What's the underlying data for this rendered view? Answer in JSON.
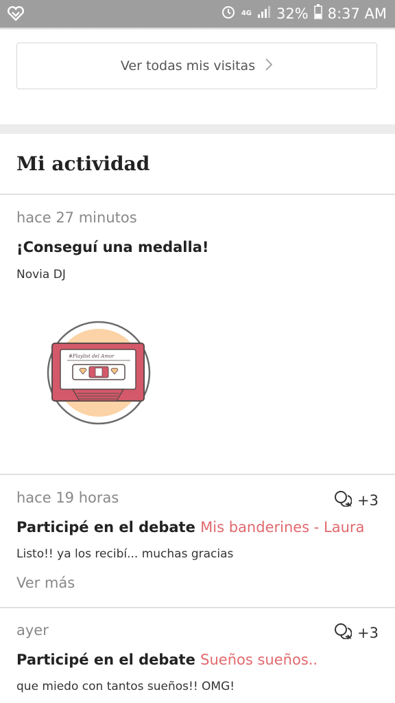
{
  "status_bar": {
    "network": "4G",
    "battery": "32%",
    "time": "8:37 AM"
  },
  "visits_button": {
    "label": "Ver todas mis visitas"
  },
  "activity": {
    "title": "Mi actividad",
    "items": [
      {
        "time": "hace 27 minutos",
        "headline": "¡Conseguí una medalla!",
        "subtitle": "Novia DJ",
        "image": {
          "banner": "#Playlist del Amor"
        }
      },
      {
        "time": "hace 19 horas",
        "comments": "+3",
        "headline": "Participé en el debate",
        "link": "Mis banderines - Laura",
        "body": "Listo!! ya los recibí... muchas gracias",
        "more": "Ver más"
      },
      {
        "time": "ayer",
        "comments": "+3",
        "headline": "Participé en el debate",
        "link": "Sueños sueños..",
        "body": "que miedo con tantos sueños!! OMG!"
      }
    ]
  },
  "colors": {
    "status_bar_bg": "#9e9e9e",
    "link": "#e1686d",
    "separator": "#ececec"
  }
}
